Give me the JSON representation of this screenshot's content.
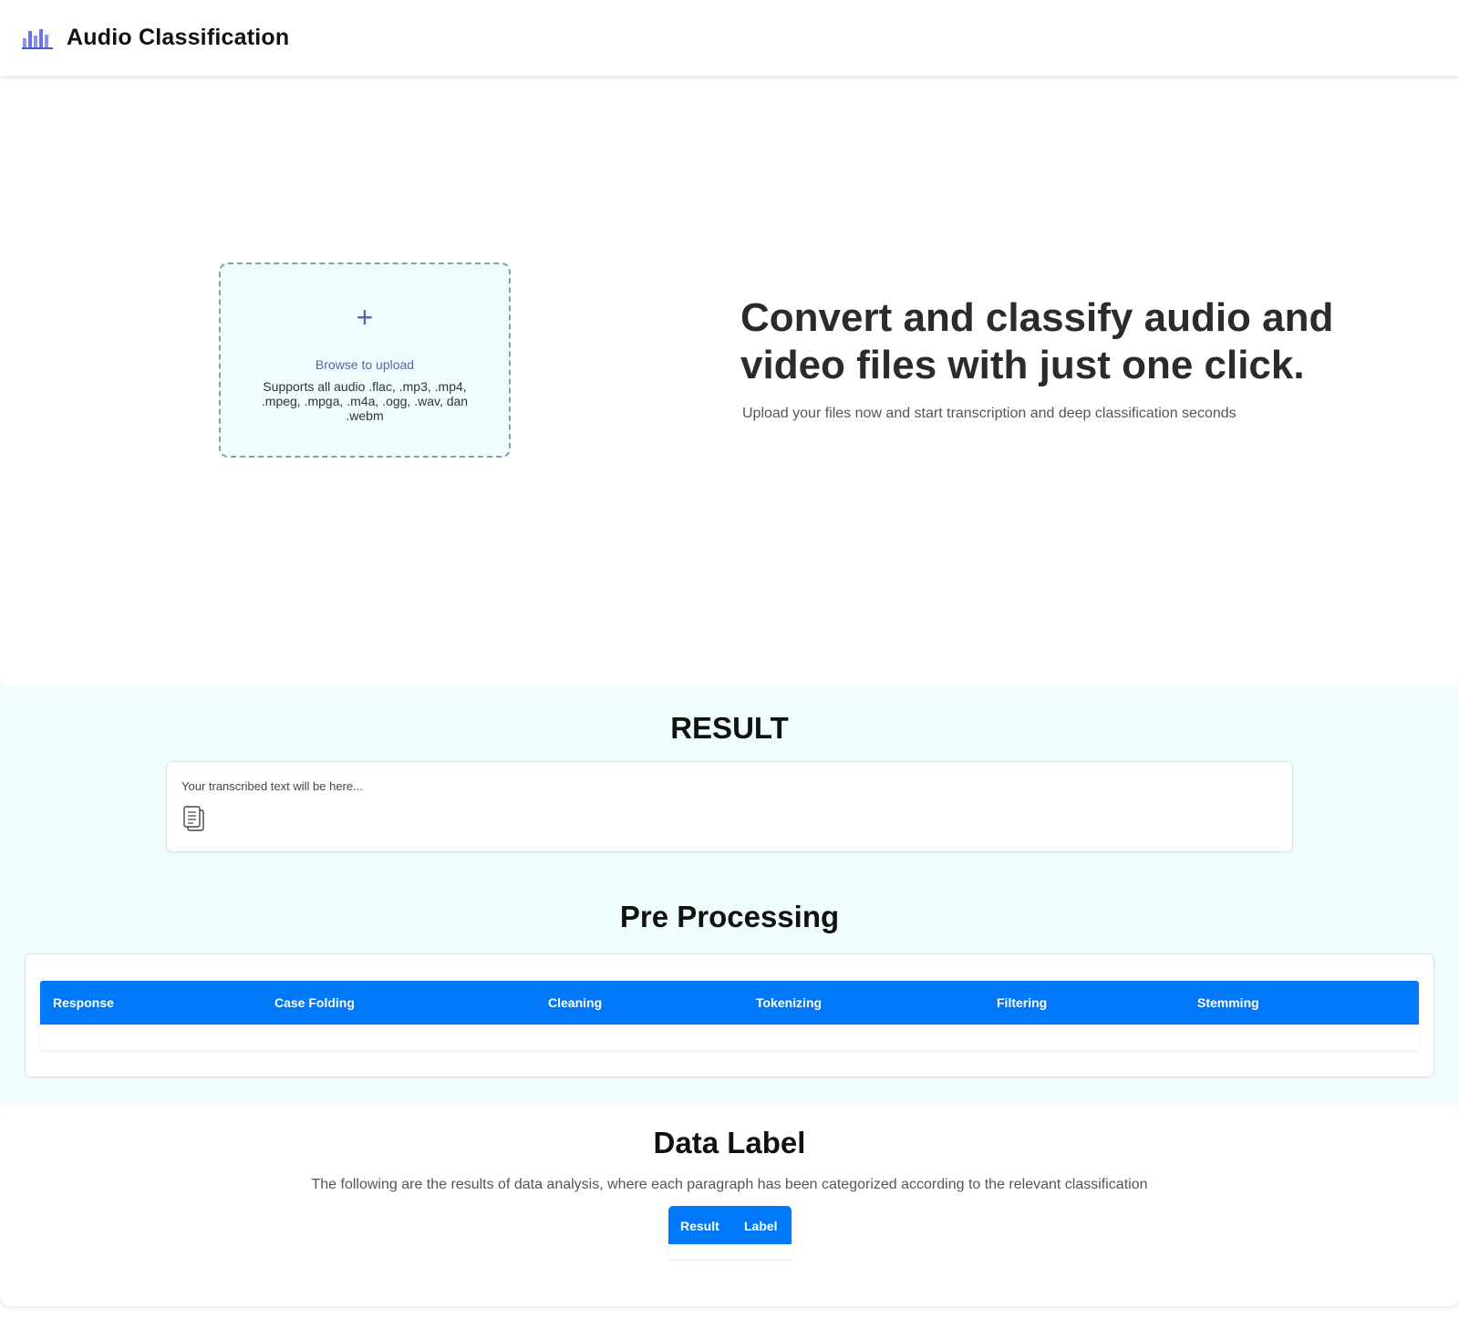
{
  "header": {
    "title": "Audio Classification",
    "logo_icon": "audio-bars-icon"
  },
  "hero": {
    "upload": {
      "plus_glyph": "+",
      "browse_label": "Browse to upload",
      "supports_text": "Supports all audio .flac, .mp3, .mp4, .mpeg, .mpga, .m4a, .ogg, .wav, dan .webm"
    },
    "headline": "Convert and classify audio and video files with just one click.",
    "subtext": "Upload your files now and start transcription and deep classification seconds"
  },
  "result": {
    "title": "RESULT",
    "placeholder": "Your transcribed text will be here...",
    "copy_icon": "copy-icon"
  },
  "preprocessing": {
    "title": "Pre Processing",
    "columns": [
      "Response",
      "Case Folding",
      "Cleaning",
      "Tokenizing",
      "Filtering",
      "Stemming"
    ]
  },
  "data_label": {
    "title": "Data Label",
    "description": "The following are the results of data analysis, where each paragraph has been categorized according to the relevant classification",
    "columns": [
      "Result",
      "Label"
    ]
  },
  "colors": {
    "accent_blue": "#0078fa",
    "section_bg": "#effdfd",
    "logo_purple": "#6c73e8"
  }
}
